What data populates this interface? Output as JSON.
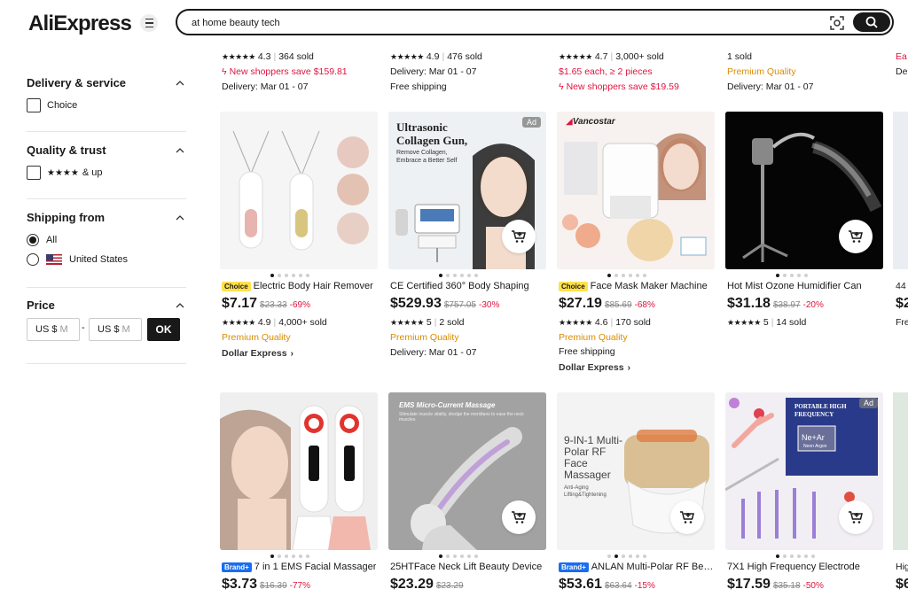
{
  "header": {
    "logo_text": "AliExpress",
    "search_value": "at home beauty tech"
  },
  "sidebar": {
    "delivery": {
      "title": "Delivery & service",
      "option": "Choice"
    },
    "quality": {
      "title": "Quality & trust",
      "stars": "★★★★",
      "option": "& up"
    },
    "shipping": {
      "title": "Shipping from",
      "opt_all": "All",
      "opt_us": "United States"
    },
    "price": {
      "title": "Price",
      "min_prefix": "US $",
      "min_ph": "M",
      "max_prefix": "US $",
      "max_ph": "M",
      "dash": "-",
      "ok": "OK"
    }
  },
  "top_partial": [
    {
      "rating": "4.3",
      "sold": "364 sold",
      "l2": "New shoppers save $159.81",
      "l3": "Delivery: Mar 01 - 07"
    },
    {
      "rating": "4.9",
      "sold": "476 sold",
      "l2": "Delivery: Mar 01 - 07",
      "l3": "Free shipping"
    },
    {
      "rating": "4.7",
      "sold": "3,000+ sold",
      "l2": "$1.65 each, ≥ 2 pieces",
      "l3": "New shoppers save $19.59"
    },
    {
      "sold": "1 sold",
      "l2": "Premium Quality",
      "l3": "Delivery: Mar 01 - 07"
    }
  ],
  "edge_top": {
    "l1": "Ea",
    "l2": "De"
  },
  "row1": [
    {
      "badge": "Choice",
      "title": "Electric Body Hair Remover",
      "price": "$7.17",
      "old": "$23.33",
      "disc": "-69%",
      "rating": "4.9",
      "sold": "4,000+ sold",
      "l2": "Premium Quality",
      "l3": "Dollar Express"
    },
    {
      "title": "CE Certified 360° Body Shaping",
      "price": "$529.93",
      "old": "$757.05",
      "disc": "-30%",
      "rating": "5",
      "sold": "2 sold",
      "l2": "Premium Quality",
      "l3": "Delivery: Mar 01 - 07",
      "ad": "Ad",
      "img_head": "Ultrasonic Collagen Gun,",
      "img_sub": "Remove Collagen, Embrace a Better Self"
    },
    {
      "badge": "Choice",
      "title": "Face Mask Maker Machine",
      "price": "$27.19",
      "old": "$85.69",
      "disc": "-68%",
      "rating": "4.6",
      "sold": "170 sold",
      "l2": "Premium Quality",
      "l3": "Free shipping",
      "l4": "Dollar Express",
      "brand_mark": "Vancostar"
    },
    {
      "title": "Hot Mist Ozone Humidifier Can",
      "price": "$31.18",
      "old": "$38.97",
      "disc": "-20%",
      "rating": "5",
      "sold": "14 sold"
    }
  ],
  "edge_row1": {
    "title": "44",
    "price": "$2",
    "l": "Fre"
  },
  "row2": [
    {
      "badge": "Brand+",
      "title": "7 in 1 EMS Facial Massager",
      "price": "$3.73",
      "old": "$16.39",
      "disc": "-77%"
    },
    {
      "title": "25HTFace Neck Lift Beauty Device",
      "price": "$23.29",
      "old": "$23.29",
      "img_head": "EMS Micro-Current Massage",
      "img_sub": "Stimulate muscle vitality, dredge the meridians to ease the neck muscles"
    },
    {
      "badge": "Brand+",
      "title": "ANLAN Multi-Polar RF Beauty",
      "price": "$53.61",
      "old": "$63.64",
      "disc": "-15%",
      "img_head": "9-IN-1 Multi-Polar RF Face Massager",
      "img_sub": "Anti-Aging Lifting&Tightening"
    },
    {
      "title": "7X1 High Frequency Electrode",
      "price": "$17.59",
      "old": "$35.18",
      "disc": "-50%",
      "ad": "Ad",
      "img_head": "PORTABLE HIGH FREQUENCY",
      "img_sub": "Ne+Ar",
      "img_sub2": "Neon Argon"
    }
  ],
  "edge_row2": {
    "title": "Hig",
    "price": "$6"
  },
  "colors": {
    "accent_red": "#e0133f",
    "premium": "#d98c00",
    "choice_yellow": "#ffe14a",
    "brand_blue": "#1a6df0"
  }
}
